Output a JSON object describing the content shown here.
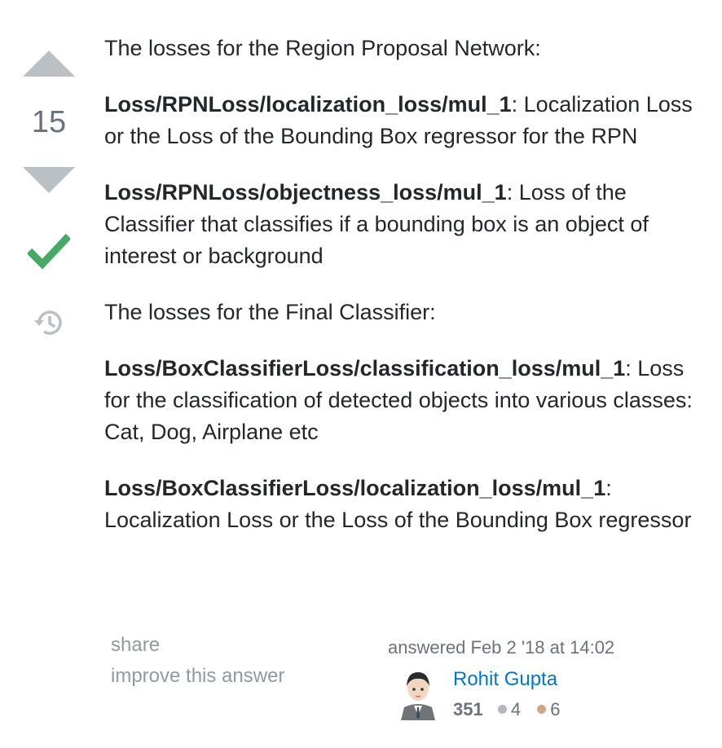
{
  "vote": {
    "count": "15",
    "accepted": true
  },
  "post": {
    "paragraphs": [
      {
        "bold": "",
        "text": "The losses for the Region Proposal Network:"
      },
      {
        "bold": "Loss/RPNLoss/localization_loss/mul_1",
        "text": ": Localization Loss or the Loss of the Bounding Box regressor for the RPN"
      },
      {
        "bold": "Loss/RPNLoss/objectness_loss/mul_1",
        "text": ": Loss of the Classifier that classifies if a bounding box is an object of interest or background"
      },
      {
        "bold": "",
        "text": "The losses for the Final Classifier:"
      },
      {
        "bold": "Loss/BoxClassifierLoss/classification_loss/mul_1",
        "text": ": Loss for the classification of detected objects into various classes: Cat, Dog, Airplane etc"
      },
      {
        "bold": "Loss/BoxClassifierLoss/localization_loss/mul_1",
        "text": ": Localization Loss or the Loss of the Bounding Box regressor"
      }
    ]
  },
  "menu": {
    "share": "share",
    "improve": "improve this answer"
  },
  "user": {
    "answered": "answered Feb 2 '18 at 14:02",
    "name": "Rohit Gupta",
    "reputation": "351",
    "silver_badges": "4",
    "bronze_badges": "6"
  },
  "colors": {
    "vote_arrow": "#bbc0c4",
    "accepted": "#48a868",
    "link": "#0077cc",
    "silver": "#b4b8bc",
    "bronze": "#d1a684"
  },
  "icons": {
    "vote_up": "triangle-up",
    "vote_down": "triangle-down",
    "accepted": "checkmark",
    "history": "clock-history"
  }
}
